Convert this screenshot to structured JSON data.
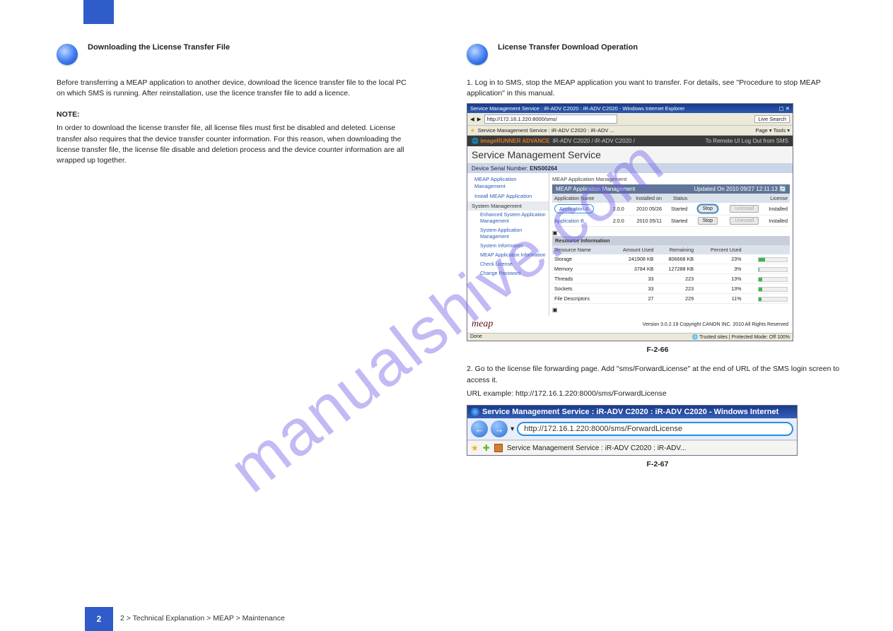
{
  "watermark": "manualshive.com",
  "left": {
    "step_title": "Downloading the License Transfer File",
    "p1": "Before transferring a MEAP application to another device, download the licence transfer file to the local PC on which SMS is running. After reinstallation, use the licence transfer file to add a licence.",
    "note_head": "NOTE:",
    "note": "In order to download the license transfer file, all license files must first be disabled and deleted. License transfer also requires that the device transfer counter information. For this reason, when downloading the license transfer file, the license file disable and deletion process and the device counter information are all wrapped up together."
  },
  "right": {
    "step_title": "License Transfer Download Operation",
    "p1": "1. Log in to SMS, stop the MEAP application you want to transfer. For details, see \"Procedure to stop MEAP application\" in this manual.",
    "fig1_label": "F-2-66",
    "fig1_caption": " ",
    "p2": "2. Go to the license file forwarding page. Add \"sms/ForwardLicense\" at the end of URL of the SMS login screen to access it.",
    "url_example": "URL example: http://172.16.1.220:8000/sms/ForwardLicense",
    "fig2_label": "F-2-67",
    "fig2_caption": " "
  },
  "sms": {
    "window_title": "Service Management Service : iR-ADV C2020 : iR-ADV C2020 - Windows Internet Explorer",
    "url": "http://172.16.1.220:8000/sms/",
    "tab_text": "Service Management Service : iR-ADV C2020 : iR-ADV ...",
    "toolbar_links": "Page ▾   Tools ▾",
    "brand": "imageRUNNER ADVANCE",
    "device": "iR-ADV C2020 / iR-ADV C2020 /",
    "remote_links": "To Remote UI   Log Out from SMS",
    "header": "Service Management Service",
    "serial_label": "Device Serial Number:",
    "serial": "ENS00264",
    "side": {
      "i1": "MEAP Application Management",
      "i2": "Install MEAP Application",
      "h1": "System Management",
      "i3": "Enhanced System Application Management",
      "i4": "System Application Management",
      "i5": "System Information",
      "i6": "MEAP Application Information",
      "i7": "Check License",
      "i8": "Change Password"
    },
    "main": {
      "breadcrumb": "MEAP Application Management",
      "panel": "MEAP Application Management",
      "updated": "Updated On 2010 09/27 12:11:13",
      "cols": {
        "name": "Application Name",
        "installed": "Installed on",
        "status": "Status",
        "license": "License"
      },
      "rows": [
        {
          "name": "Application A",
          "ver": "2.0.0",
          "installed": "2010 05/26",
          "status": "Started",
          "btn1": "Stop",
          "btn2": "Uninstall",
          "license": "Installed",
          "circle": true
        },
        {
          "name": "Application B",
          "ver": "2.0.0",
          "installed": "2010 05/11",
          "status": "Started",
          "btn1": "Stop",
          "btn2": "Uninstall",
          "license": "Installed",
          "circle": false
        }
      ],
      "res_head": "Resource Information",
      "res_cols": {
        "name": "Resource Name",
        "used": "Amount Used",
        "remain": "Remaining",
        "pct": "Percent Used"
      },
      "res_rows": [
        {
          "name": "Storage",
          "used": "241908 KB",
          "remain": "806668 KB",
          "pct": "23%",
          "w": 23
        },
        {
          "name": "Memory",
          "used": "3784 KB",
          "remain": "127288 KB",
          "pct": "3%",
          "w": 3
        },
        {
          "name": "Threads",
          "used": "33",
          "remain": "223",
          "pct": "13%",
          "w": 13
        },
        {
          "name": "Sockets",
          "used": "33",
          "remain": "223",
          "pct": "13%",
          "w": 13
        },
        {
          "name": "File Descriptors",
          "used": "27",
          "remain": "229",
          "pct": "11%",
          "w": 11
        }
      ]
    },
    "meap_logo": "meap",
    "copyright": "Version 3.0.2.19  Copyright CANON INC. 2010 All Rights Reserved",
    "status_left": "Done",
    "status_right": "Trusted sites | Protected Mode: Off     100%"
  },
  "browser": {
    "title": "Service Management Service : iR-ADV C2020 : iR-ADV C2020 - Windows Internet",
    "url": "http://172.16.1.220:8000/sms/ForwardLicense",
    "tab": "Service Management Service : iR-ADV C2020 : iR-ADV..."
  },
  "chart_data": {
    "type": "table",
    "title": "Resource Information",
    "columns": [
      "Resource Name",
      "Amount Used",
      "Remaining",
      "Percent Used"
    ],
    "rows": [
      [
        "Storage",
        "241908 KB",
        "806668 KB",
        "23%"
      ],
      [
        "Memory",
        "3784 KB",
        "127288 KB",
        "3%"
      ],
      [
        "Threads",
        33,
        223,
        "13%"
      ],
      [
        "Sockets",
        33,
        223,
        "13%"
      ],
      [
        "File Descriptors",
        27,
        229,
        "11%"
      ]
    ]
  },
  "footer": {
    "page": "2",
    "breadcrumb": "2 > Technical Explanation > MEAP > Maintenance"
  }
}
